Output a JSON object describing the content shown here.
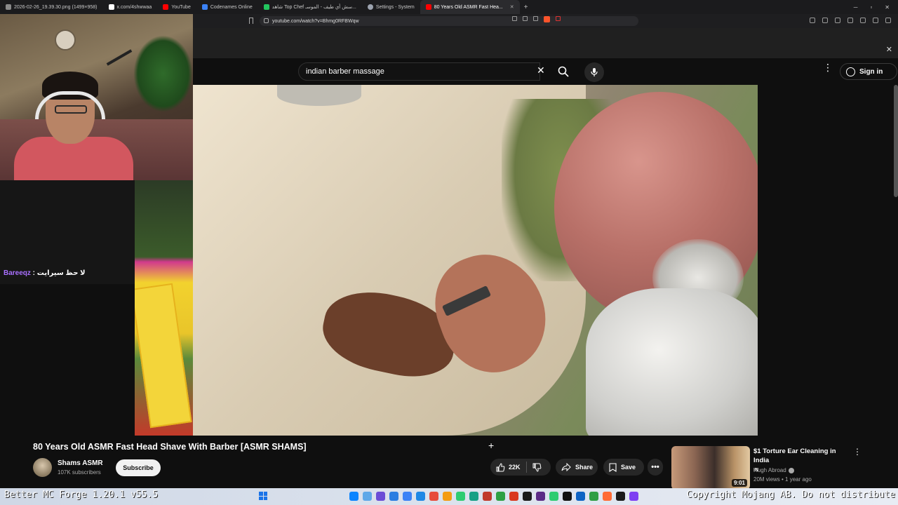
{
  "browser": {
    "tabs": [
      {
        "label": "2026-02-26_19.39.30.png (1499×958)",
        "color": "#8a8a8a"
      },
      {
        "label": "x.com/4shwwaa",
        "color": "#ffffff"
      },
      {
        "label": "YouTube",
        "color": "#ff0000"
      },
      {
        "label": "Codenames Online",
        "color": "#3b82f6"
      },
      {
        "label": "شاهد Top Chef سش أي طيف - الموسـ...",
        "color": "#22c55e"
      },
      {
        "label": "Settings - System",
        "color": "#9ca3af"
      },
      {
        "label": "80 Years Old ASMR Fast Hea...",
        "color": "#ff0000",
        "active": true
      }
    ],
    "url": "youtube.com/watch?v=Bhmg0RFBWqw"
  },
  "youtube": {
    "search_query": "indian barber massage",
    "sign_in": "Sign in"
  },
  "chat": {
    "username": "Bareeqz",
    "separator": " : ",
    "message": "لا حظ سيرايت"
  },
  "video": {
    "title": "80 Years Old ASMR Fast Head Shave With Barber [ASMR SHAMS]",
    "channel": "Shams ASMR",
    "subscribers": "107K subscribers",
    "subscribe_label": "Subscribe",
    "likes": "22K",
    "share_label": "Share",
    "save_label": "Save"
  },
  "recommended": {
    "title": "$1 Torture Ear Cleaning in India",
    "badge": "IN",
    "channel": "Hugh Abroad",
    "meta": "20M views • 1 year ago",
    "duration": "9:01"
  },
  "overlay": {
    "left_text": "Better MC Forge 1.20.1 v55.5",
    "right_text": "Copyright Mojang AB. Do not distribute"
  },
  "taskbar_icon_colors": [
    "#0a84ff",
    "#5fa8e8",
    "#6b4dd6",
    "#2a7de1",
    "#3b82f6",
    "#1e88e5",
    "#e74c3c",
    "#f39c12",
    "#2ecc71",
    "#16a085",
    "#c0392b",
    "#2ea043",
    "#d9381e",
    "#1a1a1a",
    "#5b2a86",
    "#2ecc71",
    "#111111",
    "#0e63c4",
    "#2f9e44",
    "#ff6b35",
    "#1a1a1a",
    "#7e3ff2"
  ]
}
